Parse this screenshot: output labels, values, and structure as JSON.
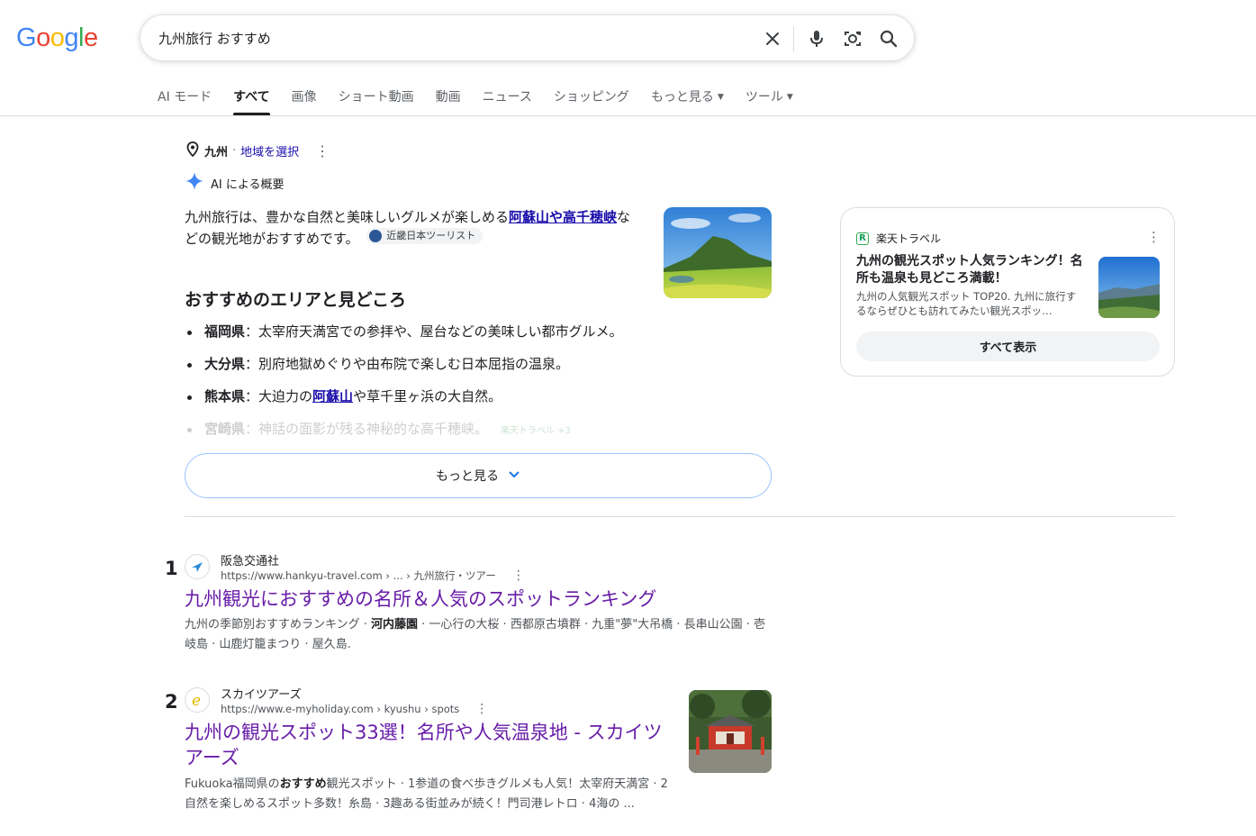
{
  "header": {
    "logo_letters": [
      "G",
      "o",
      "o",
      "g",
      "l",
      "e"
    ],
    "logo_colors": [
      "#4285f4",
      "#ea4335",
      "#fbbc05",
      "#4285f4",
      "#34a853",
      "#ea4335"
    ],
    "query": "九州旅行 おすすめ"
  },
  "tabs": [
    {
      "label": "AI モード",
      "active": false
    },
    {
      "label": "すべて",
      "active": true
    },
    {
      "label": "画像",
      "active": false
    },
    {
      "label": "ショート動画",
      "active": false
    },
    {
      "label": "動画",
      "active": false
    },
    {
      "label": "ニュース",
      "active": false
    },
    {
      "label": "ショッピング",
      "active": false
    },
    {
      "label": "もっと見る",
      "active": false,
      "caret": true
    },
    {
      "label": "ツール",
      "active": false,
      "caret": true
    }
  ],
  "location": {
    "region": "九州",
    "separator": "·",
    "select_label": "地域を選択"
  },
  "ai_overview": {
    "heading": "AI による概要",
    "intro_before": "九州旅行は、豊かな自然と美味しいグルメが楽しめる",
    "intro_link": "阿蘇山や高千穂峡",
    "intro_after": "などの観光地がおすすめです。",
    "intro_chip": "近畿日本ツーリスト",
    "section_title": "おすすめのエリアと見どころ",
    "items": [
      {
        "label": "福岡県",
        "sep": "：",
        "text": "太宰府天満宮での参拝や、屋台などの美味しい都市グルメ。"
      },
      {
        "label": "大分県",
        "sep": "：",
        "text": "別府地獄めぐりや由布院で楽しむ日本屈指の温泉。"
      },
      {
        "label": "熊本県",
        "sep": "：",
        "text_before": "大迫力の",
        "link": "阿蘇山",
        "text_after": "や草千里ヶ浜の大自然。"
      },
      {
        "label": "宮崎県",
        "sep": "：",
        "text": "神話の面影が残る神秘的な高千穂峡。",
        "mini": "楽天トラベル +3"
      }
    ],
    "more_label": "もっと見る"
  },
  "side_card": {
    "source": "楽天トラベル",
    "source_logo": "R",
    "title": "九州の観光スポット人気ランキング！名所も温泉も見どころ満載！",
    "desc": "九州の人気観光スポット TOP20. 九州に旅行するならぜひとも訪れてみたい観光スポッ…",
    "show_all": "すべて表示"
  },
  "results": [
    {
      "rank": "1",
      "site": "阪急交通社",
      "url": "https://www.hankyu-travel.com › ... › 九州旅行・ツアー",
      "title": "九州観光におすすめの名所＆人気のスポットランキング",
      "snippet_before": "九州の季節別おすすめランキング · ",
      "snippet_bold": "河内藤園",
      "snippet_after": " · 一心行の大桜 · 西都原古墳群 · 九重\"夢\"大吊橋 · 長串山公園 · 壱岐島 · 山鹿灯籠まつり · 屋久島."
    },
    {
      "rank": "2",
      "site": "スカイツアーズ",
      "url": "https://www.e-myholiday.com › kyushu › spots",
      "title": "九州の観光スポット33選！名所や人気温泉地 - スカイツアーズ",
      "snippet_before": "Fukuoka福岡県の",
      "snippet_bold": "おすすめ",
      "snippet_after": "観光スポット · 1参道の食べ歩きグルメも人気！太宰府天満宮 · 2自然を楽しめるスポット多数！糸島 · 3趣ある街並みが続く！門司港レトロ · 4海の ..."
    }
  ],
  "icons": {
    "clear": "close-icon",
    "voice": "mic-icon",
    "lens": "lens-icon",
    "search": "search-icon",
    "location": "location-pin-icon",
    "ai": "sparkle-icon",
    "chevron": "chevron-down-icon"
  }
}
